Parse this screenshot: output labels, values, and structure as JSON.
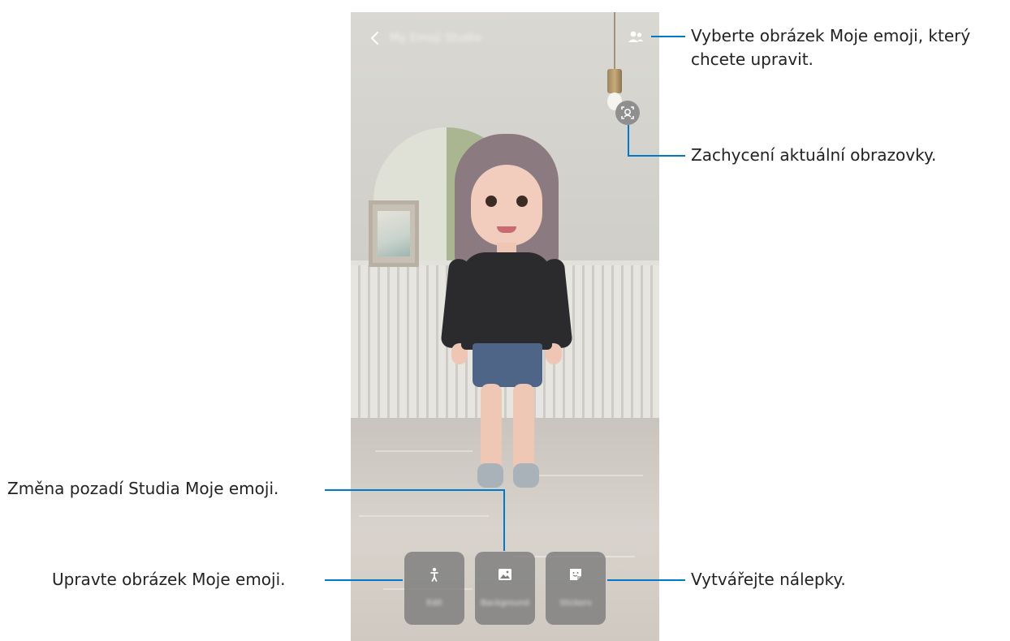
{
  "app": {
    "title": "My Emoji Studio"
  },
  "toolbar": {
    "back_icon": "back-arrow-icon",
    "switch_icon": "people-icon",
    "capture_icon": "face-capture-icon"
  },
  "bottom_tiles": [
    {
      "label": "Edit",
      "icon": "person-icon"
    },
    {
      "label": "Background",
      "icon": "image-icon"
    },
    {
      "label": "Stickers",
      "icon": "sticker-icon"
    }
  ],
  "callouts": {
    "select_emoji_line1": "Vyberte obrázek Moje emoji, který",
    "select_emoji_line2": "chcete upravit.",
    "capture_screen": "Zachycení aktuální obrazovky.",
    "change_background": "Změna pozadí Studia Moje emoji.",
    "edit_emoji": "Upravte obrázek Moje emoji.",
    "create_stickers": "Vytvářejte nálepky."
  },
  "colors": {
    "callout_line": "#0079c8",
    "tile_background": "#7d7d7d"
  }
}
